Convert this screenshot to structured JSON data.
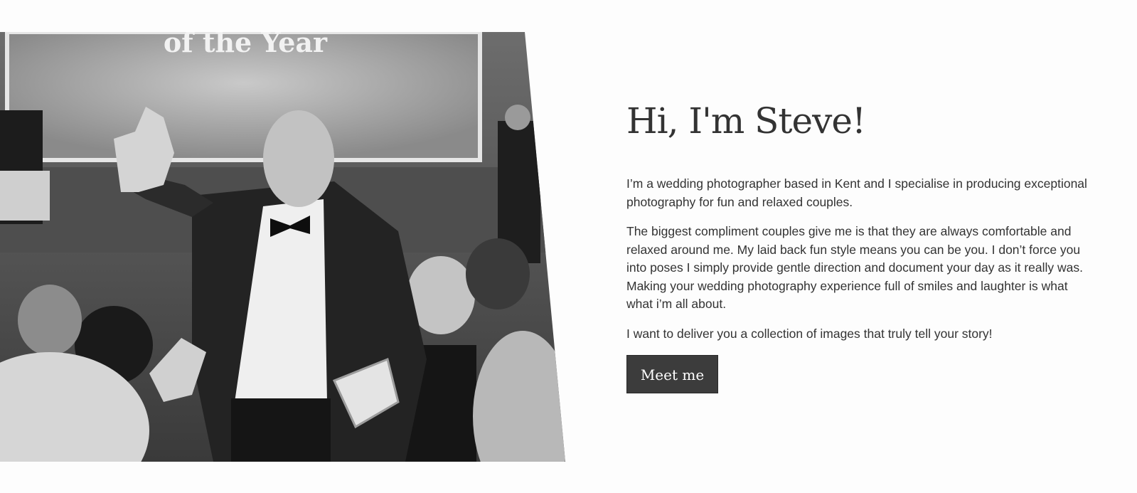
{
  "about": {
    "photo": {
      "alt": "Steve waving while collecting an award at a gala dinner",
      "screen_text": "of the Year"
    },
    "heading": "Hi, I'm Steve!",
    "paragraphs": [
      "I’m a wedding photographer based in Kent and I specialise in producing exceptional photography for fun and relaxed couples.",
      "The biggest compliment couples give me is that they are always comfortable and relaxed around me. My laid back fun style means you can be you. I don’t force you into poses I simply provide gentle direction and document your day as it really was. Making your wedding photography experience full of smiles and laughter is what what i’m all about.",
      "I want to deliver you a collection of images that truly tell your story!"
    ],
    "cta_label": "Meet me"
  },
  "colors": {
    "background": "#fdfdfd",
    "text": "#333333",
    "button_bg": "#3c3c3c",
    "button_text": "#ffffff"
  }
}
